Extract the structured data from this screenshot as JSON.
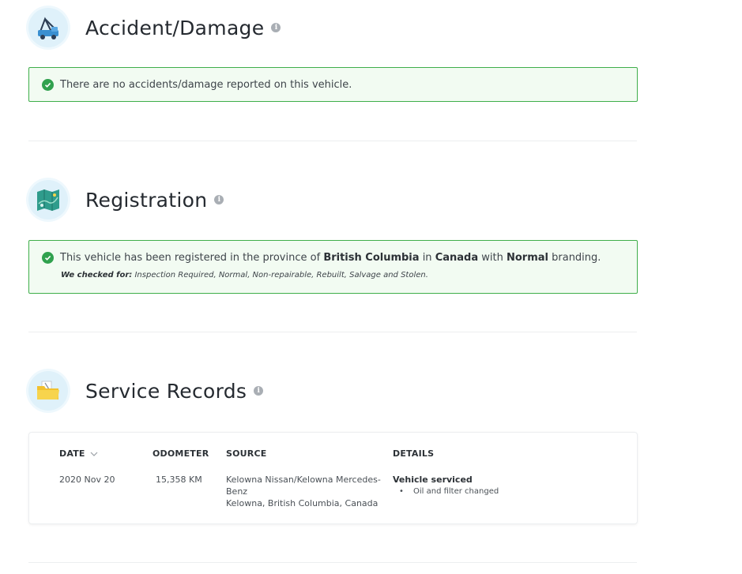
{
  "accident": {
    "title": "Accident/Damage",
    "info": "i",
    "message": "There are no accidents/damage reported on this vehicle."
  },
  "registration": {
    "title": "Registration",
    "info": "i",
    "msg_pre": "This vehicle has been registered in the province of",
    "province": "British Columbia",
    "msg_in": "in",
    "country": "Canada",
    "msg_with": "with",
    "branding": "Normal",
    "msg_post": "branding.",
    "checked_label": "We checked for:",
    "checked_items": "Inspection Required, Normal, Non-repairable, Rebuilt, Salvage and Stolen."
  },
  "service": {
    "title": "Service Records",
    "info": "i",
    "columns": {
      "date": "DATE",
      "odometer": "ODOMETER",
      "source": "SOURCE",
      "details": "DETAILS"
    },
    "records": [
      {
        "date": "2020 Nov 20",
        "odometer": "15,358 KM",
        "source_line1": "Kelowna Nissan/Kelowna Mercedes-",
        "source_line2": "Benz",
        "source_line3": "Kelowna, British Columbia, Canada",
        "detail_title": "Vehicle serviced",
        "detail_bullet": "•",
        "detail_item": "Oil and filter changed"
      }
    ]
  },
  "colors": {
    "success_border": "#3fae4a",
    "success_bg": "#f2fbf2",
    "check": "#30a14e"
  }
}
